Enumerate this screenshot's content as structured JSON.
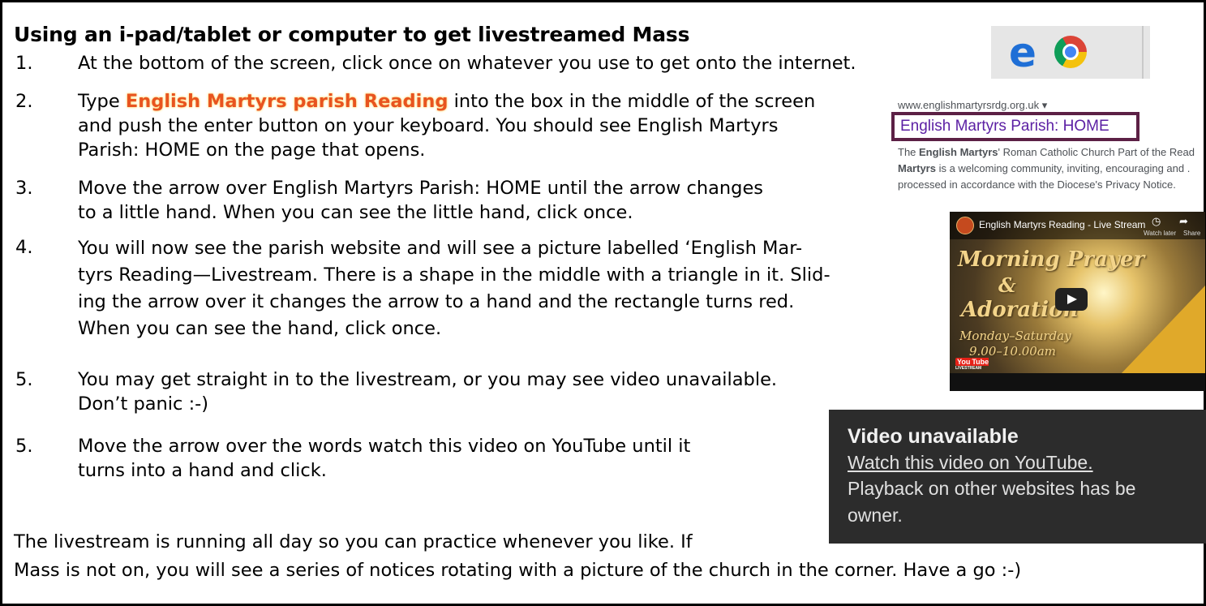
{
  "title": "Using an i-pad/tablet or computer to get livestreamed Mass",
  "steps": [
    {
      "num": "1.",
      "lines": [
        "At the bottom of the screen, click once on whatever you use to get onto the internet."
      ]
    },
    {
      "num": "2.",
      "pre": "Type ",
      "highlight": "English Martyrs parish Reading",
      "post": " into the box in the middle of the screen",
      "lines": [
        "and push the enter button on your keyboard. You should see English Martyrs",
        "Parish: HOME on the page that opens."
      ]
    },
    {
      "num": "3.",
      "lines": [
        "Move the arrow over English Martyrs Parish: HOME until the arrow changes",
        "to a little hand. When you can see the little hand, click once."
      ]
    },
    {
      "num": "4.",
      "lines": [
        "You will now see the parish website and will see a picture labelled ‘English Mar-",
        "tyrs Reading—Livestream. There is a shape in the middle with a triangle in it. Slid-",
        "ing the arrow over it changes the arrow to a hand and the rectangle turns red.",
        "When you can see the hand, click once."
      ]
    },
    {
      "num": "5.",
      "lines": [
        "You may get straight in to the livestream, or you may see video unavailable.",
        "Don’t panic :-)"
      ]
    },
    {
      "num": "5.",
      "lines": [
        "Move the arrow over the words watch this video on YouTube until it",
        "turns into a hand and click."
      ]
    }
  ],
  "footer": [
    "The livestream is running all day so you can practice whenever you like. If",
    "Mass is not on, you will see a series of notices rotating with a picture of the church in the corner. Have a go :-)"
  ],
  "browser_icons": {
    "edge": "edge-icon",
    "chrome": "chrome-icon"
  },
  "search_result": {
    "url": "www.englishmartyrsrdg.org.uk ▾",
    "title": "English Martyrs Parish: HOME",
    "desc_1_pre": "The ",
    "desc_1_bold": "English Martyrs",
    "desc_1_post": "' Roman Catholic Church Part of the Read",
    "desc_2_bold": "Martyrs",
    "desc_2_post": " is a welcoming community, inviting, encouraging and .",
    "desc_3": "processed in accordance with the Diocese's Privacy Notice."
  },
  "video": {
    "title": "English Martyrs Reading - Live Stream",
    "watch_later": "Watch later",
    "share": "Share",
    "line1": "Morning Prayer",
    "line2": "&",
    "line3": "Adoration",
    "line4": "Monday–Saturday",
    "line5": "9.00–10.00am",
    "badge_you": "You",
    "badge_tube": "Tube",
    "badge_sub": "LIVESTREAM"
  },
  "unavailable": {
    "heading": "Video unavailable",
    "link": "Watch this video on YouTube.",
    "line1": "Playback on other websites has be",
    "line2": "owner."
  }
}
